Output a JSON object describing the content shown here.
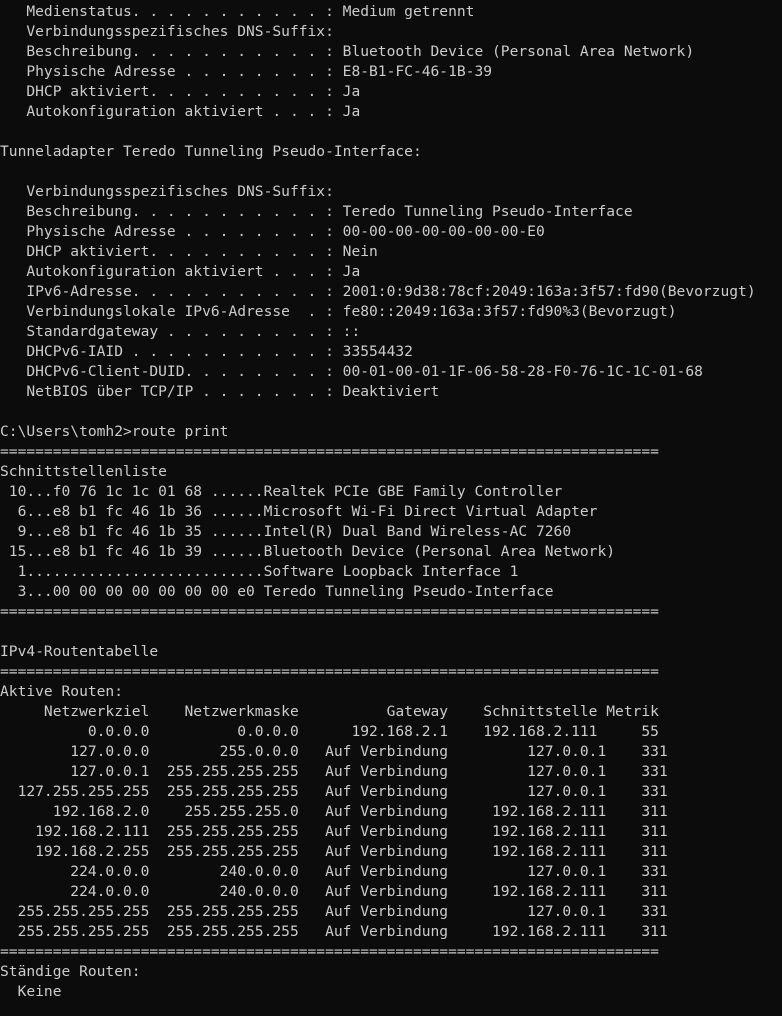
{
  "console": {
    "lines": [
      "   Medienstatus. . . . . . . . . . . : Medium getrennt",
      "   Verbindungsspezifisches DNS-Suffix:",
      "   Beschreibung. . . . . . . . . . . : Bluetooth Device (Personal Area Network)",
      "   Physische Adresse . . . . . . . . : E8-B1-FC-46-1B-39",
      "   DHCP aktiviert. . . . . . . . . . : Ja",
      "   Autokonfiguration aktiviert . . . : Ja",
      "",
      "Tunneladapter Teredo Tunneling Pseudo-Interface:",
      "",
      "   Verbindungsspezifisches DNS-Suffix:",
      "   Beschreibung. . . . . . . . . . . : Teredo Tunneling Pseudo-Interface",
      "   Physische Adresse . . . . . . . . : 00-00-00-00-00-00-00-E0",
      "   DHCP aktiviert. . . . . . . . . . : Nein",
      "   Autokonfiguration aktiviert . . . : Ja",
      "   IPv6-Adresse. . . . . . . . . . . : 2001:0:9d38:78cf:2049:163a:3f57:fd90(Bevorzugt)",
      "   Verbindungslokale IPv6-Adresse  . : fe80::2049:163a:3f57:fd90%3(Bevorzugt)",
      "   Standardgateway . . . . . . . . . : ::",
      "   DHCPv6-IAID . . . . . . . . . . . : 33554432",
      "   DHCPv6-Client-DUID. . . . . . . . : 00-01-00-01-1F-06-58-28-F0-76-1C-1C-01-68",
      "   NetBIOS über TCP/IP . . . . . . . : Deaktiviert",
      "",
      "C:\\Users\\tomh2>route print",
      "===========================================================================",
      "Schnittstellenliste",
      " 10...f0 76 1c 1c 01 68 ......Realtek PCIe GBE Family Controller",
      "  6...e8 b1 fc 46 1b 36 ......Microsoft Wi-Fi Direct Virtual Adapter",
      "  9...e8 b1 fc 46 1b 35 ......Intel(R) Dual Band Wireless-AC 7260",
      " 15...e8 b1 fc 46 1b 39 ......Bluetooth Device (Personal Area Network)",
      "  1...........................Software Loopback Interface 1",
      "  3...00 00 00 00 00 00 00 e0 Teredo Tunneling Pseudo-Interface",
      "===========================================================================",
      "",
      "IPv4-Routentabelle",
      "===========================================================================",
      "Aktive Routen:",
      "     Netzwerkziel    Netzwerkmaske          Gateway    Schnittstelle Metrik",
      "          0.0.0.0          0.0.0.0      192.168.2.1    192.168.2.111     55",
      "        127.0.0.0        255.0.0.0   Auf Verbindung         127.0.0.1    331",
      "        127.0.0.1  255.255.255.255   Auf Verbindung         127.0.0.1    331",
      "  127.255.255.255  255.255.255.255   Auf Verbindung         127.0.0.1    331",
      "      192.168.2.0    255.255.255.0   Auf Verbindung     192.168.2.111    311",
      "    192.168.2.111  255.255.255.255   Auf Verbindung     192.168.2.111    311",
      "    192.168.2.255  255.255.255.255   Auf Verbindung     192.168.2.111    311",
      "        224.0.0.0        240.0.0.0   Auf Verbindung         127.0.0.1    331",
      "        224.0.0.0        240.0.0.0   Auf Verbindung     192.168.2.111    311",
      "  255.255.255.255  255.255.255.255   Auf Verbindung         127.0.0.1    331",
      "  255.255.255.255  255.255.255.255   Auf Verbindung     192.168.2.111    311",
      "===========================================================================",
      "Ständige Routen:",
      "  Keine"
    ]
  },
  "colors": {
    "background": "#0c0c0c",
    "foreground": "#cccccc"
  }
}
